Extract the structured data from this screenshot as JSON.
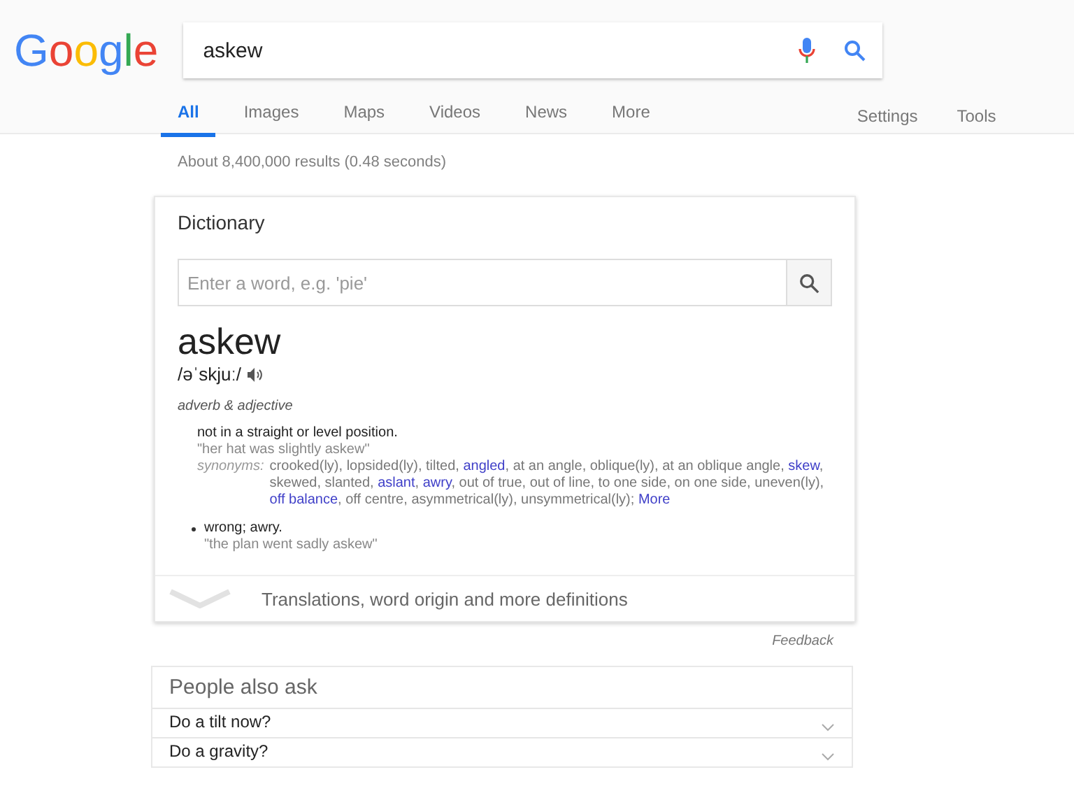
{
  "logo": {
    "letters": [
      {
        "text": "G",
        "color": "#4285f4"
      },
      {
        "text": "o",
        "color": "#ea4335"
      },
      {
        "text": "o",
        "color": "#fbbc05"
      },
      {
        "text": "g",
        "color": "#4285f4"
      },
      {
        "text": "l",
        "color": "#34a853"
      },
      {
        "text": "e",
        "color": "#ea4335"
      }
    ]
  },
  "search": {
    "value": "askew"
  },
  "tabs": [
    {
      "label": "All",
      "selected": true
    },
    {
      "label": "Images",
      "selected": false
    },
    {
      "label": "Maps",
      "selected": false
    },
    {
      "label": "Videos",
      "selected": false
    },
    {
      "label": "News",
      "selected": false
    },
    {
      "label": "More",
      "selected": false
    }
  ],
  "tools": [
    "Settings",
    "Tools"
  ],
  "result_stats": "About 8,400,000 results (0.48 seconds)",
  "dictionary": {
    "title": "Dictionary",
    "lookup": {
      "placeholder": "Enter a word, e.g. 'pie'"
    },
    "word": "askew",
    "pronunciation": "/əˈskjuː/",
    "part_of_speech": "adverb & adjective",
    "senses": [
      {
        "definition": "not in a straight or level position.",
        "example": "\"her hat was slightly askew\"",
        "synonyms_label": "synonyms:",
        "synonyms": [
          {
            "text": "crooked(ly)",
            "link": false,
            "after": ","
          },
          {
            "text": "lopsided(ly)",
            "link": false,
            "after": ","
          },
          {
            "text": "tilted",
            "link": false,
            "after": ","
          },
          {
            "text": "angled",
            "link": true,
            "after": ","
          },
          {
            "text": "at an angle",
            "link": false,
            "after": ","
          },
          {
            "text": "oblique(ly)",
            "link": false,
            "after": ","
          },
          {
            "text": "at an oblique angle",
            "link": false,
            "after": ","
          },
          {
            "text": "skew",
            "link": true,
            "after": ","
          },
          {
            "text": "skewed",
            "link": false,
            "after": ","
          },
          {
            "text": "slanted",
            "link": false,
            "after": ","
          },
          {
            "text": "aslant",
            "link": true,
            "after": ","
          },
          {
            "text": "awry",
            "link": true,
            "after": ","
          },
          {
            "text": "out of true",
            "link": false,
            "after": ","
          },
          {
            "text": "out of line",
            "link": false,
            "after": ","
          },
          {
            "text": "to one side",
            "link": false,
            "after": ","
          },
          {
            "text": "on one side",
            "link": false,
            "after": ","
          },
          {
            "text": "uneven(ly)",
            "link": false,
            "after": ","
          },
          {
            "text": "off balance",
            "link": true,
            "after": ","
          },
          {
            "text": "off centre",
            "link": false,
            "after": ","
          },
          {
            "text": "asymmetrical(ly)",
            "link": false,
            "after": ","
          },
          {
            "text": "unsymmetrical(ly)",
            "link": false,
            "after": ";"
          }
        ],
        "more": "More",
        "bullet": false
      },
      {
        "definition": "wrong; awry.",
        "example": "\"the plan went sadly askew\"",
        "bullet": true
      }
    ],
    "expander": "Translations, word origin and more definitions"
  },
  "feedback": "Feedback",
  "people_also_ask": {
    "title": "People also ask",
    "questions": [
      {
        "text": "Do a tilt now?",
        "expanded": false
      },
      {
        "text": "Do a gravity?",
        "expanded": false
      }
    ]
  }
}
